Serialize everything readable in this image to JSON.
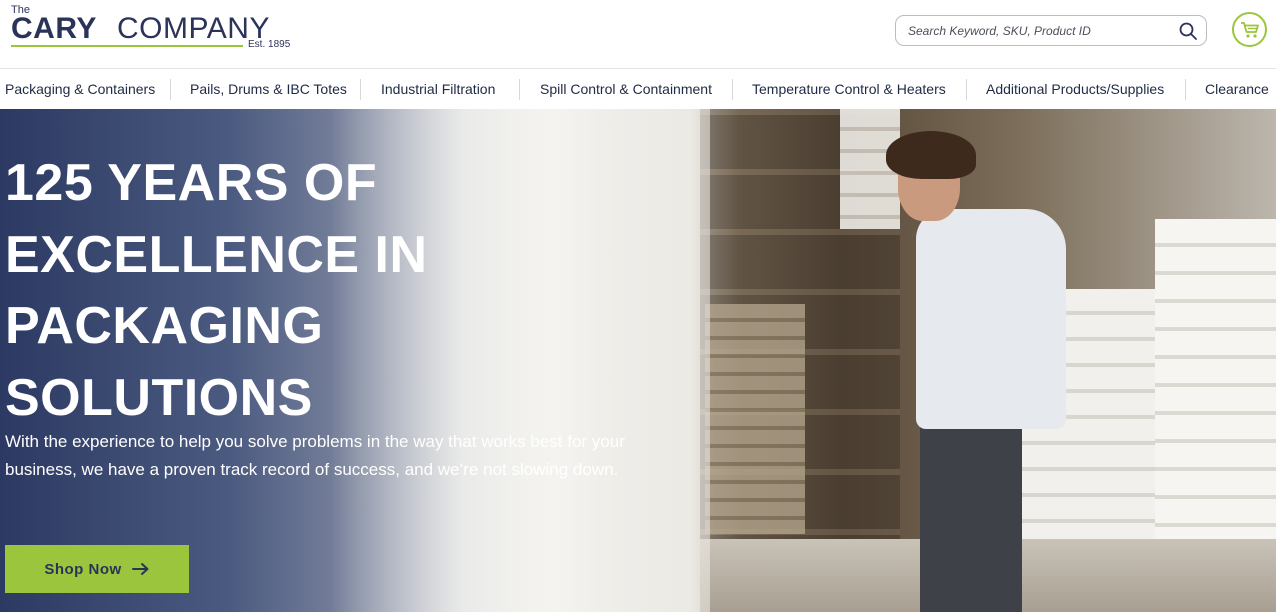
{
  "header": {
    "logo": {
      "the": "The",
      "cary": "CARY",
      "company": "COMPANY",
      "est": "Est. 1895"
    },
    "search": {
      "placeholder": "Search Keyword, SKU, Product ID",
      "icon": "search-icon"
    },
    "cart": {
      "icon": "shopping-cart-icon"
    }
  },
  "nav": {
    "items": [
      {
        "label": "Packaging & Containers"
      },
      {
        "label": "Pails, Drums & IBC Totes"
      },
      {
        "label": "Industrial Filtration"
      },
      {
        "label": "Spill Control & Containment"
      },
      {
        "label": "Temperature Control & Heaters"
      },
      {
        "label": "Additional Products/Supplies"
      },
      {
        "label": "Clearance"
      }
    ]
  },
  "hero": {
    "title_lines": [
      "125 YEARS OF",
      "EXCELLENCE IN",
      "PACKAGING",
      "SOLUTIONS"
    ],
    "subtitle": "With the experience to help you solve problems in the way that works best for your business, we have a proven track record of success, and we’re not slowing down.",
    "cta": {
      "label": "Shop Now",
      "icon": "arrow-right-icon"
    }
  },
  "colors": {
    "brand_navy": "#2c3359",
    "brand_green": "#9bc53d"
  }
}
